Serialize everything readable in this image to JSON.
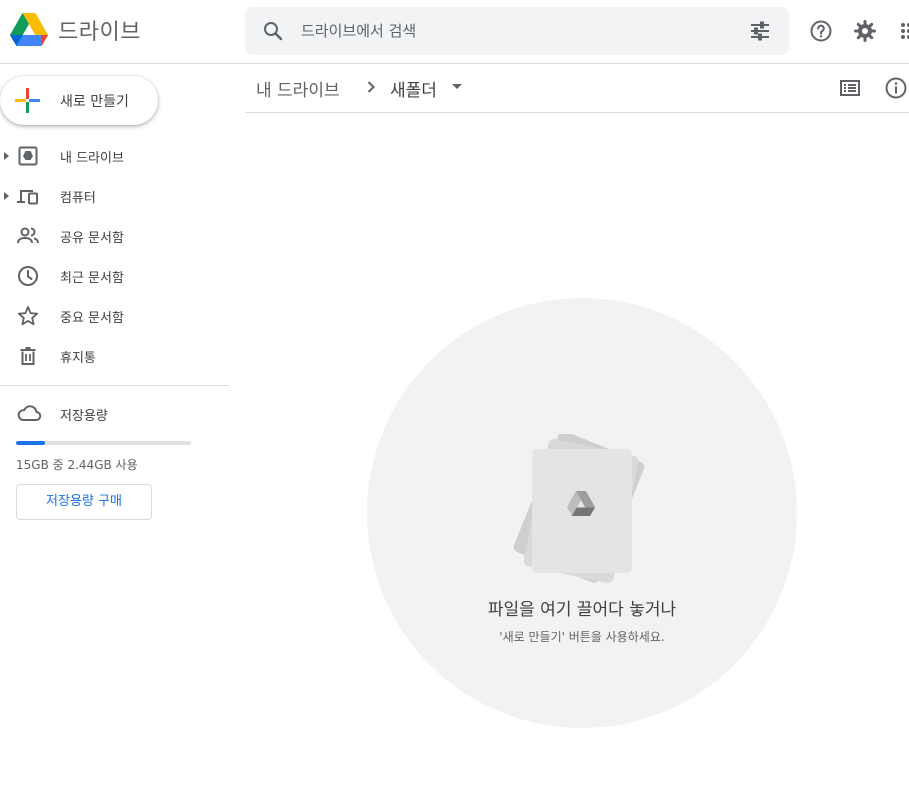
{
  "header": {
    "app_title": "드라이브",
    "logo_icon": "google-drive-logo",
    "search_placeholder": "드라이브에서 검색",
    "search_icon": "search-icon",
    "options_icon": "tune-icon",
    "help_icon": "help-icon",
    "settings_icon": "gear-icon",
    "apps_icon": "apps-grid-icon"
  },
  "sidebar": {
    "new_button_label": "새로 만들기",
    "items": [
      {
        "label": "내 드라이브",
        "icon": "my-drive-icon",
        "expandable": true
      },
      {
        "label": "컴퓨터",
        "icon": "computers-icon",
        "expandable": true
      },
      {
        "label": "공유 문서함",
        "icon": "shared-people-icon",
        "expandable": false
      },
      {
        "label": "최근 문서함",
        "icon": "clock-icon",
        "expandable": false
      },
      {
        "label": "중요 문서함",
        "icon": "star-icon",
        "expandable": false
      },
      {
        "label": "휴지통",
        "icon": "trash-icon",
        "expandable": false
      }
    ],
    "storage": {
      "label": "저장용량",
      "icon": "cloud-icon",
      "usage_text": "15GB 중 2.44GB 사용",
      "used_fraction": 0.163,
      "buy_label": "저장용량 구매"
    }
  },
  "breadcrumb": {
    "root": "내 드라이브",
    "current": "새폴더",
    "list_view_icon": "list-view-icon",
    "info_icon": "info-icon"
  },
  "empty_state": {
    "title": "파일을 여기 끌어다 놓거나",
    "subtitle": "'새로 만들기' 버튼을 사용하세요."
  },
  "colors": {
    "accent": "#1a73e8",
    "icon_gray": "#5f6368",
    "drop_zone_bg": "#f2f2f2",
    "drive_green": "#0f9d58",
    "drive_yellow": "#fbbc04",
    "drive_blue": "#4285f4",
    "drive_red": "#ea4335"
  }
}
